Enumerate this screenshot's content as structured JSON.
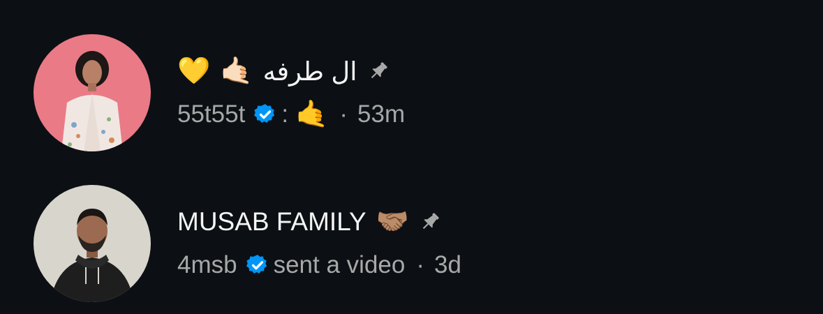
{
  "conversations": [
    {
      "title": "ال طرفه",
      "title_emojis": [
        "🤙🏻",
        "💛"
      ],
      "pinned": true,
      "username": "55t55t",
      "verified": true,
      "preview_prefix": ":",
      "preview": "🤙",
      "separator": "·",
      "time": "53m",
      "avatar_bg": "#ea7a86"
    },
    {
      "title": "MUSAB FAMILY",
      "title_emoji": "🤝🏽",
      "pinned": true,
      "username": "4msb",
      "verified": true,
      "preview": "sent a video",
      "separator": "·",
      "time": "3d",
      "avatar_bg": "#d8d5cc"
    }
  ],
  "colors": {
    "background": "#0c1014",
    "title_text": "#f5f5f5",
    "secondary_text": "#a8a8a8",
    "verified_blue": "#0095f6",
    "pin_gray": "#a8a8a8"
  }
}
